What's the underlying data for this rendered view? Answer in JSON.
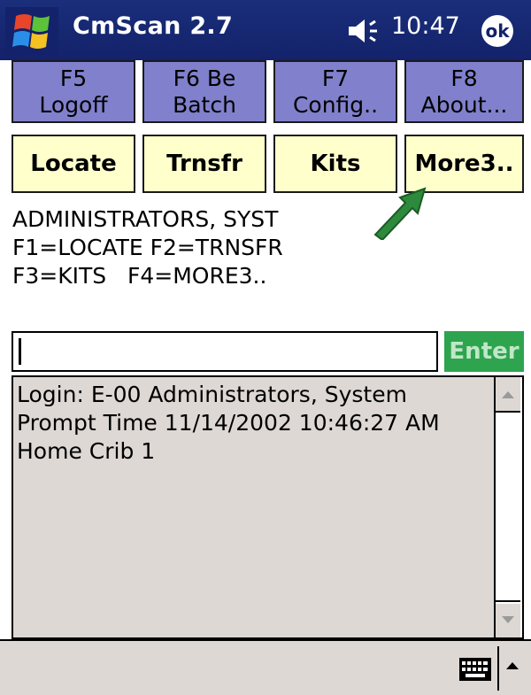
{
  "title_bar": {
    "app_title": "CmScan 2.7",
    "time": "10:47",
    "ok_label": "ok",
    "start_icon": "windows-flag-icon",
    "volume_icon": "speaker-icon"
  },
  "function_keys": [
    {
      "line1": "F5",
      "line2": "Logoff"
    },
    {
      "line1": "F6 Be",
      "line2": "Batch"
    },
    {
      "line1": "F7",
      "line2": "Config.."
    },
    {
      "line1": "F8",
      "line2": "About..."
    }
  ],
  "actions": [
    {
      "label": "Locate"
    },
    {
      "label": "Trnsfr"
    },
    {
      "label": "Kits"
    },
    {
      "label": "More3.."
    }
  ],
  "info": {
    "line1": "ADMINISTRATORS, SYST",
    "line2": "F1=LOCATE F2=TRNSFR",
    "line3": "F3=KITS   F4=MORE3.."
  },
  "input": {
    "value": "",
    "enter_label": "Enter"
  },
  "log": {
    "lines": [
      "Login: E-00 Administrators, System",
      "Prompt Time 11/14/2002 10:46:27 AM",
      "Home Crib 1"
    ]
  },
  "colors": {
    "title_bar": "#13226a",
    "fkey": "#8080cc",
    "action": "#ffffcc",
    "enter": "#2ea44f",
    "arrow": "#2d8a3c",
    "panel": "#ddd8d4"
  },
  "bottom_bar": {
    "keyboard_icon": "keyboard-icon",
    "sip_icon": "chevron-up-icon"
  }
}
